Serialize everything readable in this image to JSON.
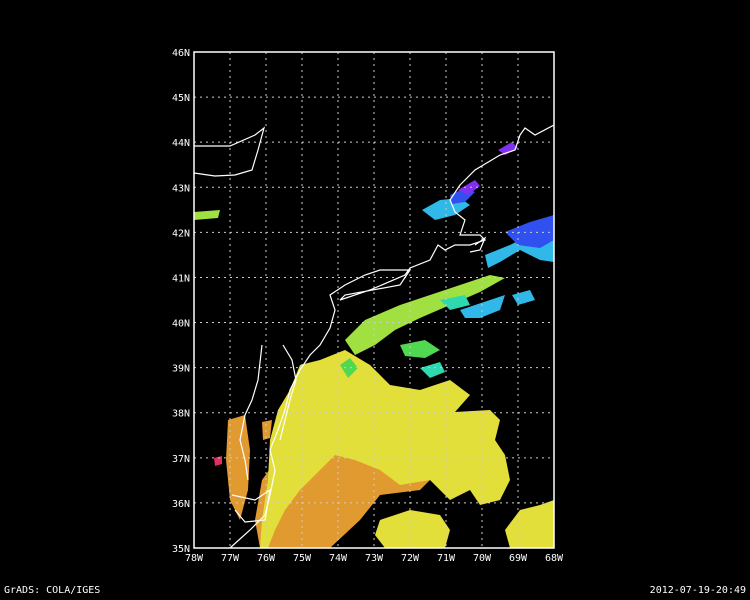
{
  "map": {
    "lat_labels": [
      "35N",
      "36N",
      "37N",
      "38N",
      "39N",
      "40N",
      "41N",
      "42N",
      "43N",
      "44N",
      "45N",
      "46N"
    ],
    "lon_labels": [
      "78W",
      "77W",
      "76W",
      "75W",
      "74W",
      "73W",
      "72W",
      "71W",
      "70W",
      "69W",
      "68W"
    ],
    "lat_range": [
      35,
      46
    ],
    "lon_range": [
      -78,
      -68
    ],
    "grid": "dotted",
    "colors": {
      "background": "#000000",
      "frame": "#ffffff",
      "coastline": "#ffffff",
      "yellow": "#e3df3a",
      "orange": "#e09a30",
      "light_green": "#a0e040",
      "green": "#50d850",
      "teal": "#30d8b0",
      "cyan": "#30b8e8",
      "blue": "#3050f0",
      "violet": "#8030f0",
      "magenta": "#c030c0",
      "red": "#e03060"
    }
  },
  "footer": {
    "left": "GrADS: COLA/IGES",
    "right": "2012-07-19-20:49"
  }
}
